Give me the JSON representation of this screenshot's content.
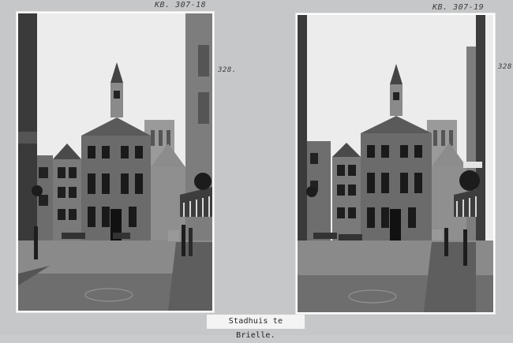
{
  "photos": [
    {
      "id_label": "KB. 307-18",
      "side_number": "328."
    },
    {
      "id_label": "KB. 307-19",
      "side_number": "328"
    }
  ],
  "caption": "Stadhuis te Brielle."
}
